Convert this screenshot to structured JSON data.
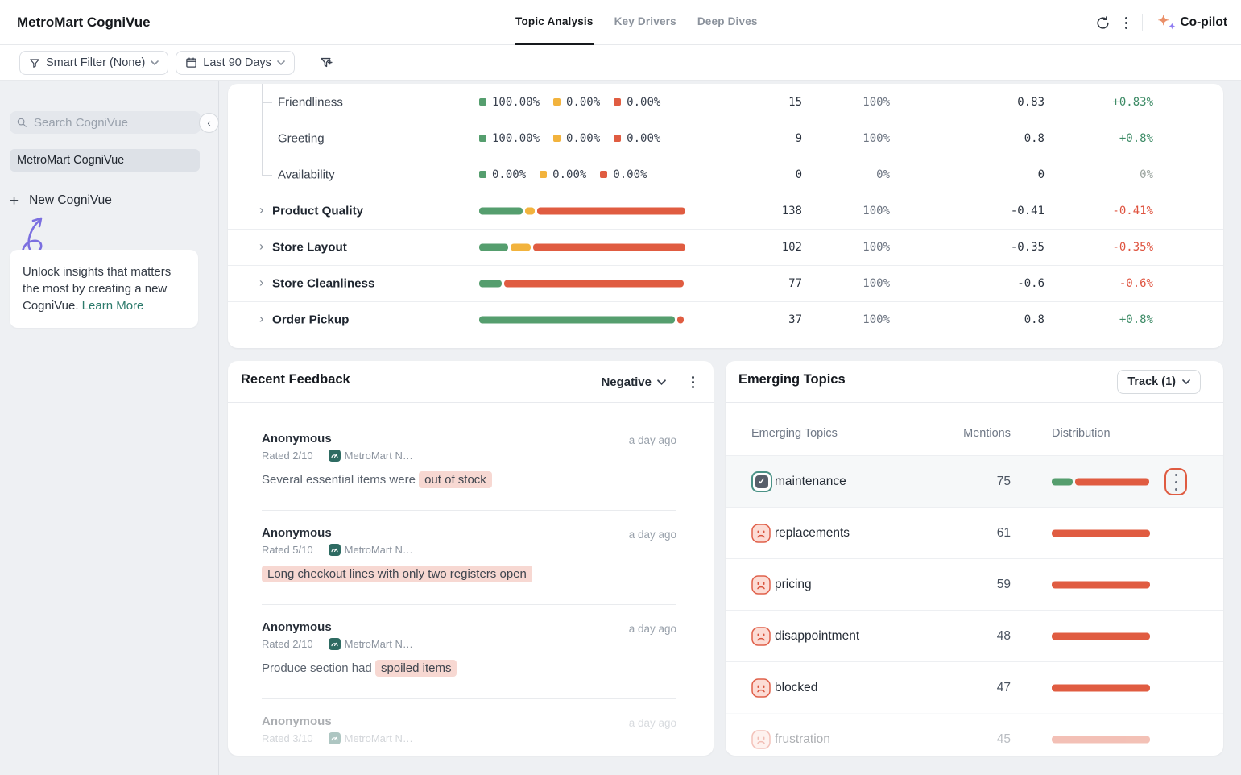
{
  "header": {
    "brand": "MetroMart CogniVue",
    "tabs": [
      {
        "label": "Topic Analysis",
        "active": true
      },
      {
        "label": "Key Drivers",
        "active": false
      },
      {
        "label": "Deep Dives",
        "active": false
      }
    ],
    "copilot_label": "Co-pilot"
  },
  "filter_bar": {
    "smart_filter": "Smart Filter (None)",
    "date_range": "Last 90 Days"
  },
  "sidebar": {
    "search_placeholder": "Search CogniVue",
    "selected_item": "MetroMart CogniVue",
    "new_cognivue": "New CogniVue",
    "promo_text": "Unlock insights that matters the most by creating a new CogniVue.",
    "promo_link_label": "Learn More"
  },
  "topics_table": {
    "sub_rows": [
      {
        "label": "Friendliness",
        "legend": {
          "positive": "100.00%",
          "neutral": "0.00%",
          "negative": "0.00%"
        },
        "mentions": "15",
        "share": "100%",
        "score": "0.83",
        "change": "+0.83%"
      },
      {
        "label": "Greeting",
        "legend": {
          "positive": "100.00%",
          "neutral": "0.00%",
          "negative": "0.00%"
        },
        "mentions": "9",
        "share": "100%",
        "score": "0.8",
        "change": "+0.8%"
      },
      {
        "label": "Availability",
        "legend": {
          "positive": "0.00%",
          "neutral": "0.00%",
          "negative": "0.00%"
        },
        "mentions": "0",
        "share": "0%",
        "score": "0",
        "change": "0%"
      }
    ],
    "parent_rows": [
      {
        "label": "Product Quality",
        "bar": {
          "positive": 21,
          "neutral": 5,
          "negative": 72
        },
        "mentions": "138",
        "share": "100%",
        "score": "-0.41",
        "change": "-0.41%"
      },
      {
        "label": "Store Layout",
        "bar": {
          "positive": 14,
          "neutral": 10,
          "negative": 74
        },
        "mentions": "102",
        "share": "100%",
        "score": "-0.35",
        "change": "-0.35%"
      },
      {
        "label": "Store Cleanliness",
        "bar": {
          "positive": 11,
          "neutral": 0,
          "negative": 87
        },
        "mentions": "77",
        "share": "100%",
        "score": "-0.6",
        "change": "-0.6%"
      },
      {
        "label": "Order Pickup",
        "bar": {
          "positive": 95,
          "neutral": 0,
          "negative": 3
        },
        "mentions": "37",
        "share": "100%",
        "score": "0.8",
        "change": "+0.8%"
      }
    ]
  },
  "recent_feedback": {
    "title": "Recent Feedback",
    "filter_label": "Negative",
    "items": [
      {
        "author": "Anonymous",
        "rating": "Rated 2/10",
        "source": "MetroMart N…",
        "time": "a day ago",
        "text_before": "Several essential items were ",
        "highlight": "out of stock"
      },
      {
        "author": "Anonymous",
        "rating": "Rated 5/10",
        "source": "MetroMart N…",
        "time": "a day ago",
        "text_before": "",
        "highlight": "Long checkout lines with only two registers open"
      },
      {
        "author": "Anonymous",
        "rating": "Rated 2/10",
        "source": "MetroMart N…",
        "time": "a day ago",
        "text_before": "Produce section had ",
        "highlight": "spoiled items"
      },
      {
        "author": "Anonymous",
        "rating": "Rated 3/10",
        "source": "MetroMart N…",
        "time": "a day ago",
        "text_before": "",
        "highlight": ""
      }
    ]
  },
  "emerging_topics": {
    "title": "Emerging Topics",
    "track_button": "Track (1)",
    "columns": {
      "topic": "Emerging Topics",
      "mentions": "Mentions",
      "distribution": "Distribution"
    },
    "rows": [
      {
        "topic": "maintenance",
        "mentions": "75",
        "tracked": true,
        "dist": {
          "positive": 21,
          "negative": 76
        }
      },
      {
        "topic": "replacements",
        "mentions": "61",
        "tracked": false,
        "dist": {
          "positive": 0,
          "negative": 100
        }
      },
      {
        "topic": "pricing",
        "mentions": "59",
        "tracked": false,
        "dist": {
          "positive": 0,
          "negative": 100
        }
      },
      {
        "topic": "disappointment",
        "mentions": "48",
        "tracked": false,
        "dist": {
          "positive": 0,
          "negative": 100
        }
      },
      {
        "topic": "blocked",
        "mentions": "47",
        "tracked": false,
        "dist": {
          "positive": 0,
          "negative": 100
        }
      },
      {
        "topic": "frustration",
        "mentions": "45",
        "tracked": false,
        "faded": true,
        "dist": {
          "positive": 0,
          "negative": 100
        }
      }
    ]
  },
  "colors": {
    "positive_green": "#559e6e",
    "neutral_amber": "#f2b33d",
    "negative_red": "#e05c41",
    "highlight_pink": "#f7d8d2",
    "link_teal": "#2c7a6b",
    "copilot_orange": "#ea8f68",
    "copilot_purple": "#8f7cf2",
    "doodle_purple": "#7b6fe0"
  }
}
